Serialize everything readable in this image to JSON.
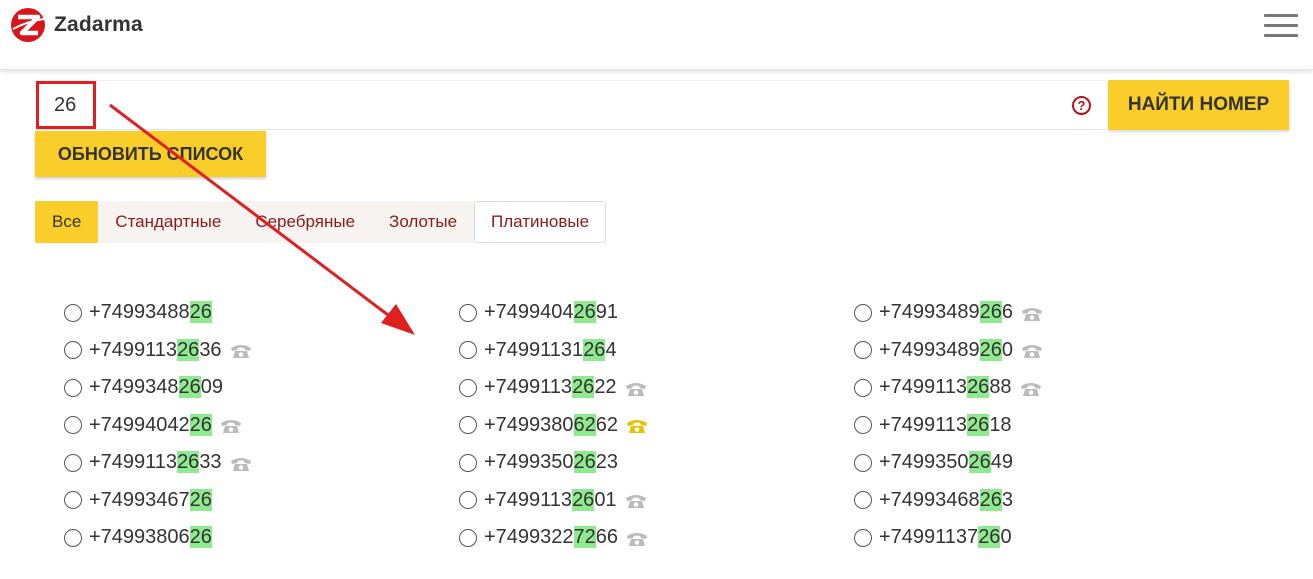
{
  "header": {
    "brand": "Zadarma",
    "logo_icon": "zadarma-logo-icon",
    "menu_icon": "hamburger-menu-icon"
  },
  "search": {
    "value": "26",
    "help_icon": "question-icon",
    "find_label": "НАЙТИ НОМЕР"
  },
  "refresh_label": "ОБНОВИТЬ СПИСОК",
  "tabs": [
    {
      "label": "Все"
    },
    {
      "label": "Стандартные"
    },
    {
      "label": "Серебряные"
    },
    {
      "label": "Золотые"
    },
    {
      "label": "Платиновые"
    }
  ],
  "colors": {
    "accent": "#f9ce2b",
    "tab_text": "#8b1a1a",
    "match_highlight": "#8fe98f",
    "annotation": "#e02020",
    "phone_grey": "#bbbbbb",
    "phone_gold": "#e8c200"
  },
  "numbers": [
    [
      {
        "pre": "+74993488",
        "hl": "26",
        "post": "",
        "phone": ""
      },
      {
        "pre": "+7499113",
        "hl": "26",
        "post": "36",
        "phone": "grey"
      },
      {
        "pre": "+7499348",
        "hl": "26",
        "post": "09",
        "phone": ""
      },
      {
        "pre": "+74994042",
        "hl": "26",
        "post": "",
        "phone": "grey"
      },
      {
        "pre": "+7499113",
        "hl": "26",
        "post": "33",
        "phone": "grey"
      },
      {
        "pre": "+74993467",
        "hl": "26",
        "post": "",
        "phone": ""
      },
      {
        "pre": "+74993806",
        "hl": "26",
        "post": "",
        "phone": ""
      }
    ],
    [
      {
        "pre": "+7499404",
        "hl": "26",
        "post": "91",
        "phone": ""
      },
      {
        "pre": "+74991131",
        "hl": "26",
        "post": "4",
        "phone": ""
      },
      {
        "pre": "+7499113",
        "hl": "26",
        "post": "22",
        "phone": "grey"
      },
      {
        "pre": "+7499380",
        "hl": "62",
        "post": "62",
        "phone": "gold"
      },
      {
        "pre": "+7499350",
        "hl": "26",
        "post": "23",
        "phone": ""
      },
      {
        "pre": "+7499113",
        "hl": "26",
        "post": "01",
        "phone": "grey"
      },
      {
        "pre": "+7499322",
        "hl": "72",
        "post": "66",
        "phone": "grey"
      }
    ],
    [
      {
        "pre": "+74993489",
        "hl": "26",
        "post": "6",
        "phone": "grey"
      },
      {
        "pre": "+74993489",
        "hl": "26",
        "post": "0",
        "phone": "grey"
      },
      {
        "pre": "+7499113",
        "hl": "26",
        "post": "88",
        "phone": "grey"
      },
      {
        "pre": "+7499113",
        "hl": "26",
        "post": "18",
        "phone": ""
      },
      {
        "pre": "+7499350",
        "hl": "26",
        "post": "49",
        "phone": ""
      },
      {
        "pre": "+74993468",
        "hl": "26",
        "post": "3",
        "phone": ""
      },
      {
        "pre": "+74991137",
        "hl": "26",
        "post": "0",
        "phone": ""
      }
    ]
  ]
}
